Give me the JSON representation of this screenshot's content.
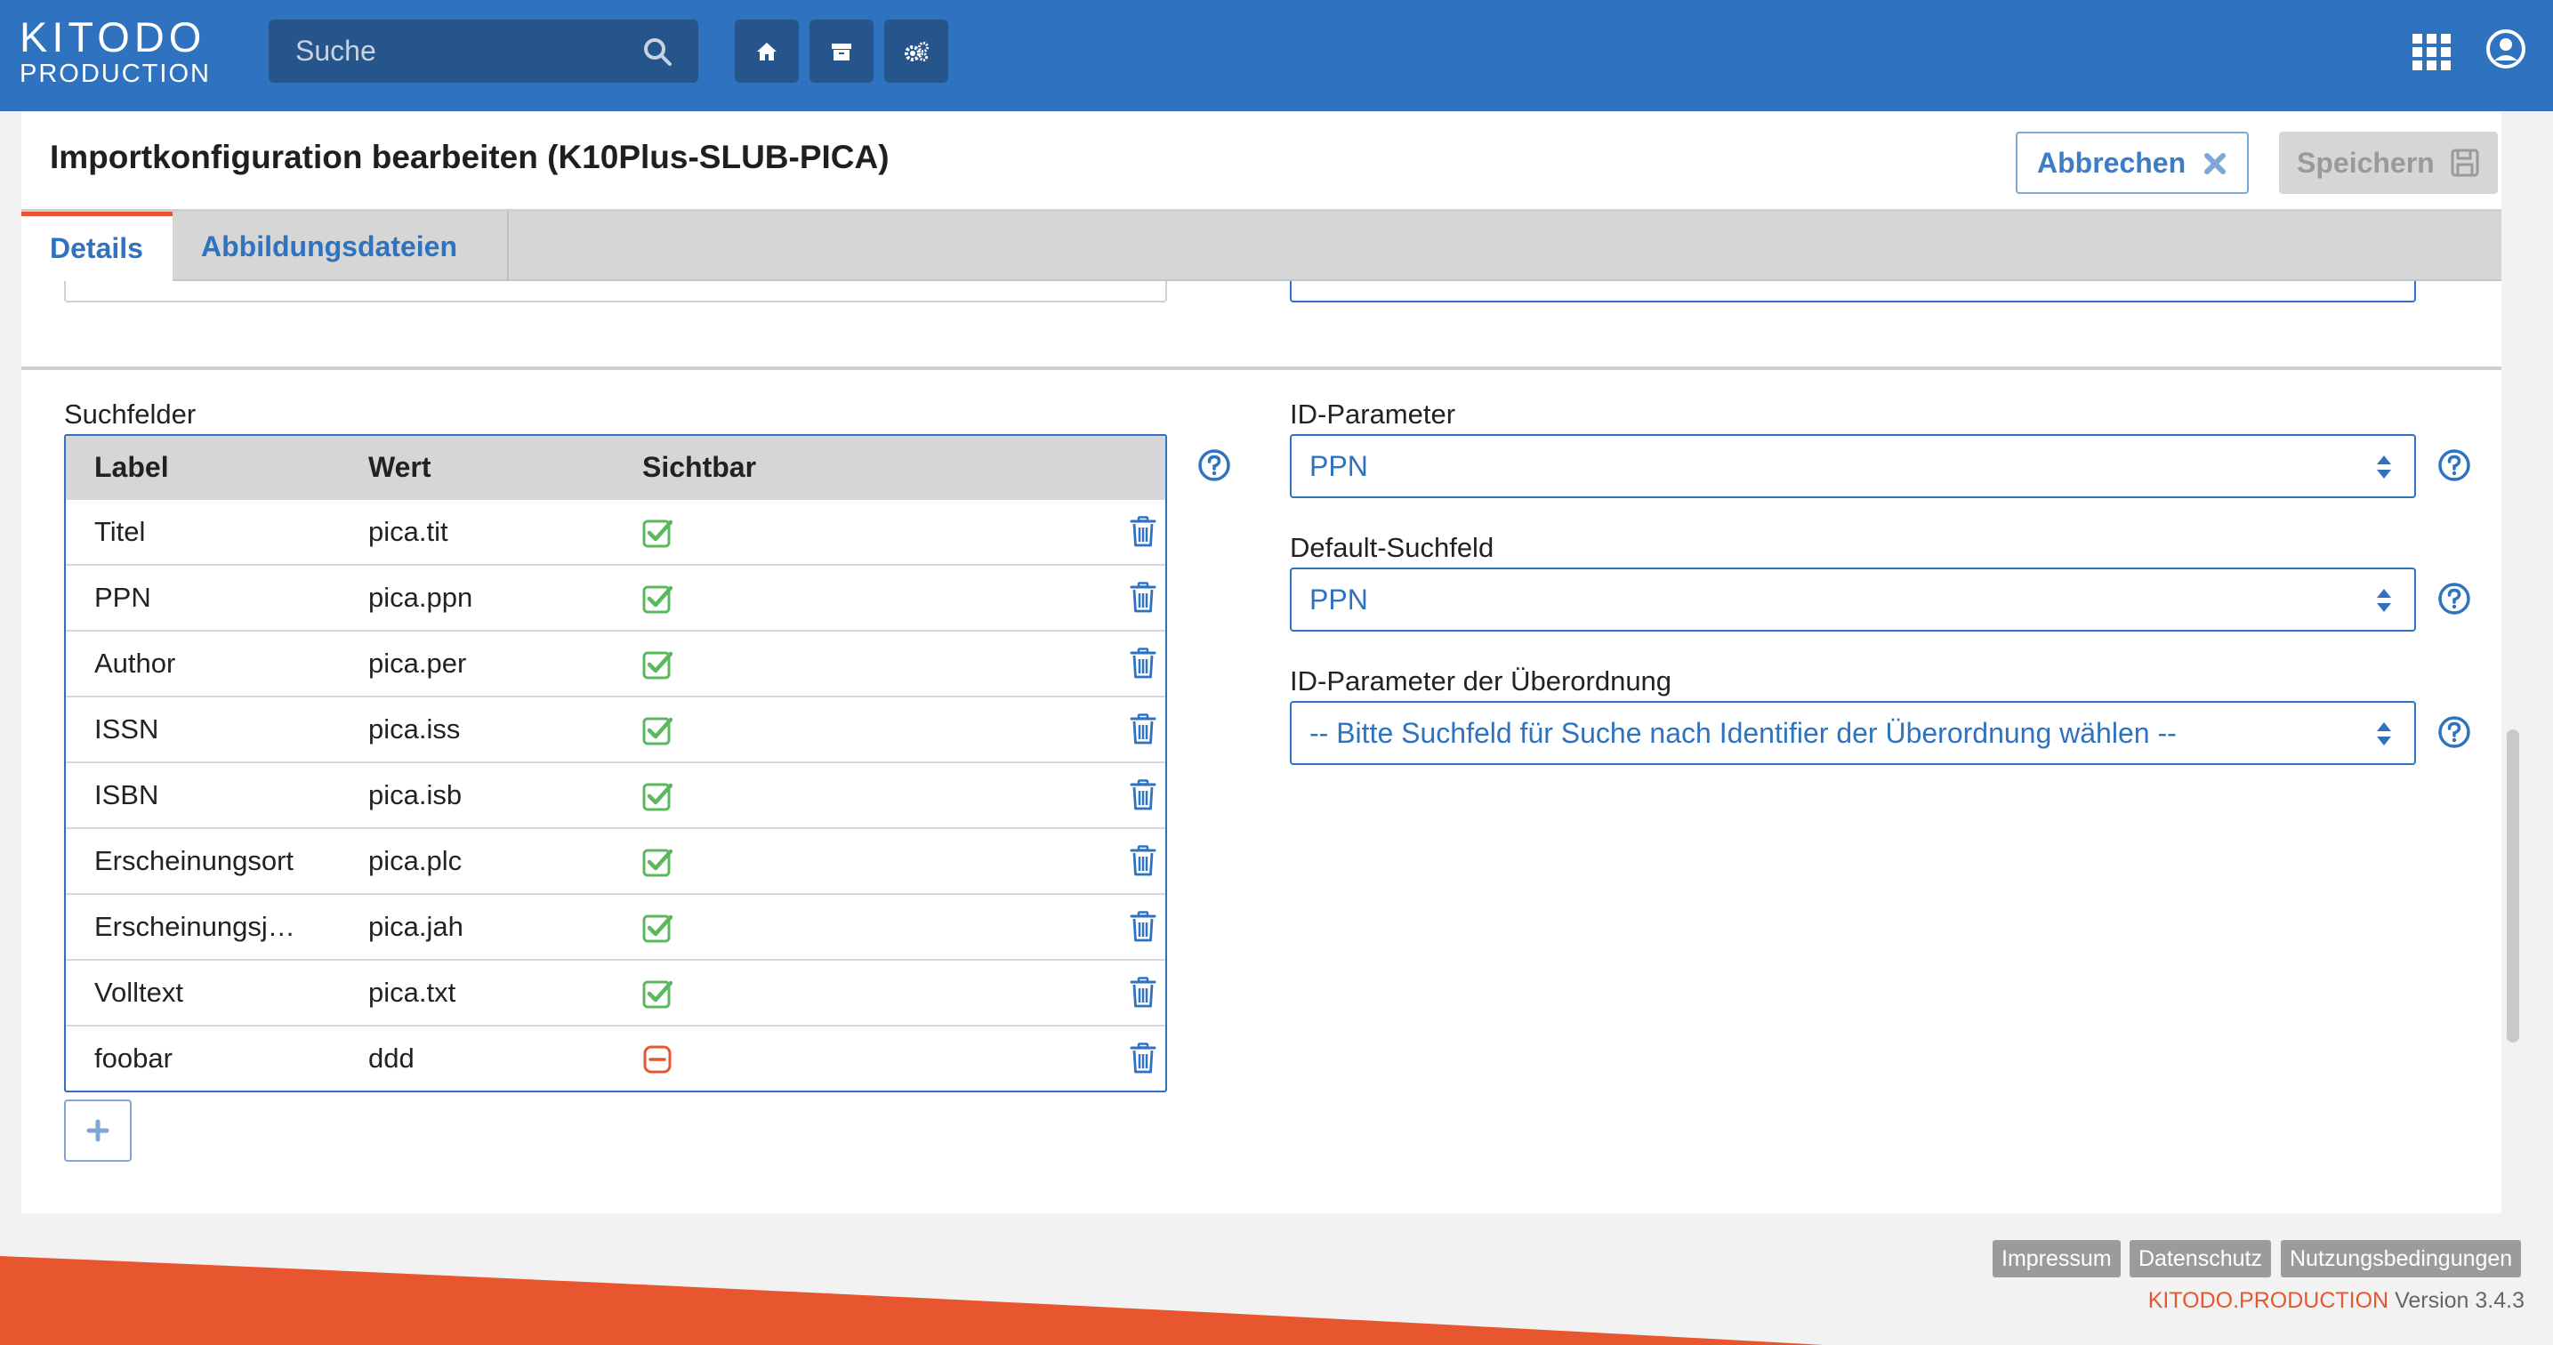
{
  "header": {
    "logo_line1": "KITODO",
    "logo_line2": "PRODUCTION",
    "search_placeholder": "Suche",
    "nav_icons": [
      "home-icon",
      "archive-icon",
      "cogs-icon"
    ],
    "right_icons": [
      "apps-grid-icon",
      "user-icon"
    ]
  },
  "page": {
    "title": "Importkonfiguration bearbeiten (K10Plus-SLUB-PICA)",
    "cancel_label": "Abbrechen",
    "save_label": "Speichern"
  },
  "tabs": [
    {
      "label": "Details",
      "active": true
    },
    {
      "label": "Abbildungsdateien",
      "active": false
    }
  ],
  "search_fields": {
    "label": "Suchfelder",
    "columns": [
      "Label",
      "Wert",
      "Sichtbar"
    ],
    "rows": [
      {
        "label": "Titel",
        "value": "pica.tit",
        "visible": true
      },
      {
        "label": "PPN",
        "value": "pica.ppn",
        "visible": true
      },
      {
        "label": "Author",
        "value": "pica.per",
        "visible": true
      },
      {
        "label": "ISSN",
        "value": "pica.iss",
        "visible": true
      },
      {
        "label": "ISBN",
        "value": "pica.isb",
        "visible": true
      },
      {
        "label": "Erscheinungsort",
        "value": "pica.plc",
        "visible": true
      },
      {
        "label": "Erscheinungsj…",
        "value": "pica.jah",
        "visible": true
      },
      {
        "label": "Volltext",
        "value": "pica.txt",
        "visible": true
      },
      {
        "label": "foobar",
        "value": "ddd",
        "visible": false
      }
    ],
    "add_label": "+"
  },
  "id_parameter": {
    "label": "ID-Parameter",
    "value": "PPN"
  },
  "default_search_field": {
    "label": "Default-Suchfeld",
    "value": "PPN"
  },
  "parent_id_parameter": {
    "label": "ID-Parameter der Überordnung",
    "value": "-- Bitte Suchfeld für Suche nach Identifier der Überordnung wählen --"
  },
  "footer": {
    "links": [
      "Impressum",
      "Datenschutz",
      "Nutzungsbedingungen"
    ],
    "brand": "KITODO.PRODUCTION",
    "version": "Version 3.4.3"
  },
  "colors": {
    "primary": "#2f72bf",
    "accent": "#e8562f",
    "check_green": "#5cb85c",
    "minus_red": "#e8562f"
  }
}
